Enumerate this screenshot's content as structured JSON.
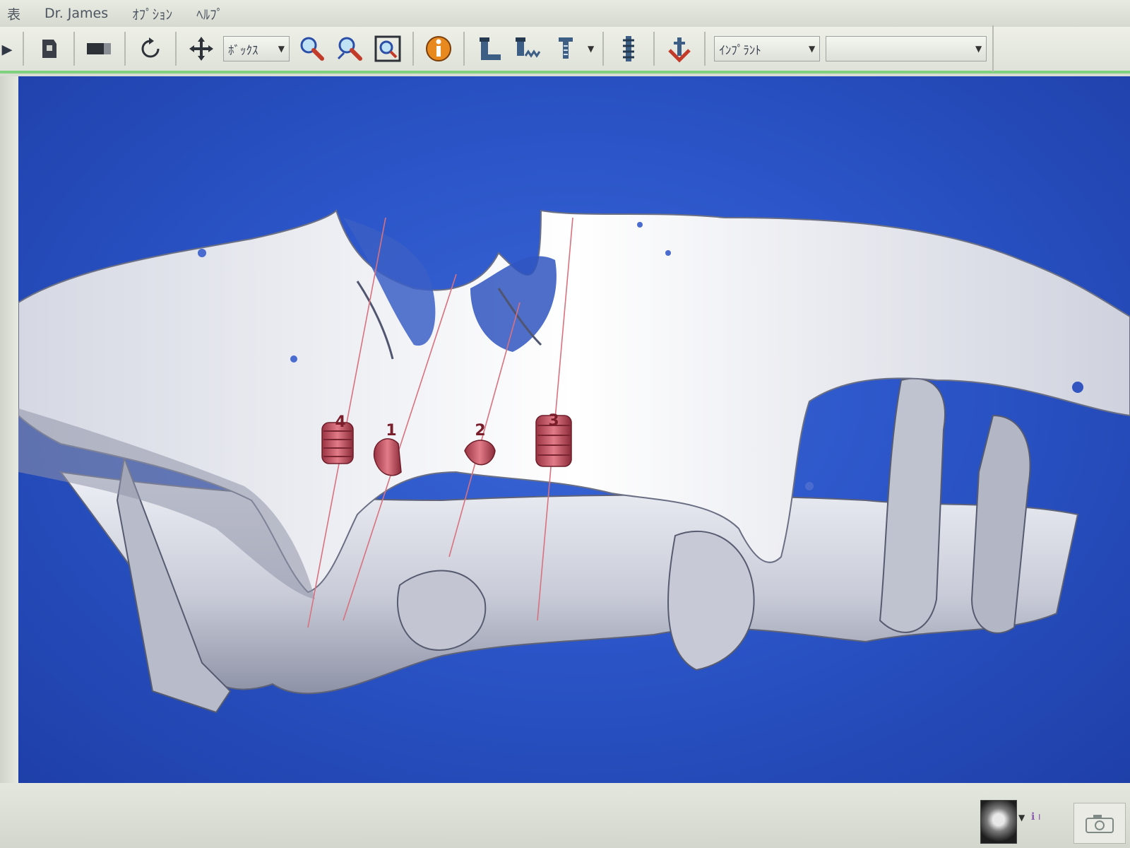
{
  "menu": {
    "items": [
      "表",
      "Dr. James",
      "ｵﾌﾟｼｮﾝ",
      "ﾍﾙﾌﾟ"
    ]
  },
  "toolbar": {
    "view_mode_combo": "ﾎﾞｯｸｽ",
    "object_combo": "ｲﾝﾌﾟﾗﾝﾄ",
    "object_combo_2": "",
    "icons": [
      "select-icon",
      "bookmark-icon",
      "layer-icon",
      "rotate-icon",
      "pan-icon",
      "zoom-icon",
      "zoom-window-icon",
      "fit-view-icon",
      "info-icon",
      "implant-tool-a-icon",
      "implant-tool-b-icon",
      "implant-placement-icon",
      "bone-density-icon",
      "anchor-icon"
    ]
  },
  "viewport": {
    "implants": [
      {
        "label": "4",
        "color": "#c0505f"
      },
      {
        "label": "1",
        "color": "#c0505f"
      },
      {
        "label": "2",
        "color": "#c0505f"
      },
      {
        "label": "3",
        "color": "#c0505f"
      }
    ],
    "background_color": "#2b55c8",
    "bone_color": "#d8dbe6"
  },
  "statusbar": {
    "thumbnail_icon": "skull-thumbnail-icon",
    "info": "ℹ ı",
    "corner_icon": "camera-icon"
  }
}
